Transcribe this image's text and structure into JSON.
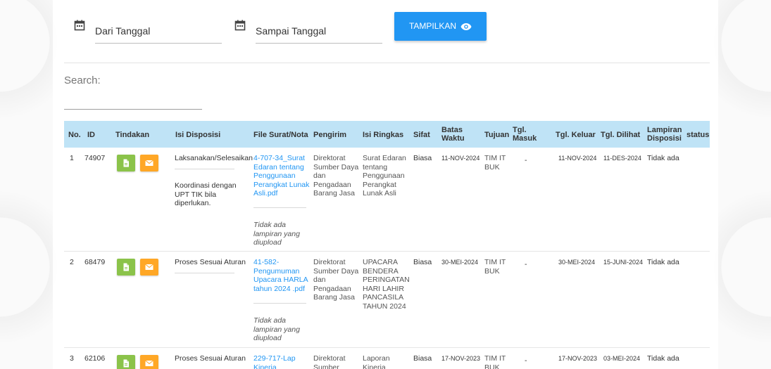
{
  "filters": {
    "from_label": "Dari Tanggal",
    "to_label": "Sampai Tanggal",
    "show_button": "TAMPILKAN",
    "search_label": "Search:"
  },
  "table": {
    "headers": {
      "no": "No.",
      "id": "ID",
      "action": "Tindakan",
      "disposition": "Isi Disposisi",
      "file": "File Surat/Nota",
      "sender": "Pengirim",
      "summary": "Isi Ringkas",
      "nature": "Sifat",
      "deadline": "Batas Waktu",
      "target": "Tujuan",
      "in_date": "Tgl. Masuk",
      "out_date": "Tgl. Keluar",
      "seen_date": "Tgl. Dilihat",
      "attachment": "Lampiran Disposisi",
      "status": "status"
    },
    "rows": [
      {
        "no": "1",
        "id": "74907",
        "disposition_1": "Laksanakan/Selesaikan",
        "disposition_2": "Koordinasi dengan UPT TIK bila diperlukan.",
        "file": "4-707-34_Surat Edaran tentang Penggunaan Perangkat Lunak Asli.pdf",
        "no_attachment": "Tidak ada lampiran yang diupload",
        "sender": "Direktorat Sumber Daya dan Pengadaan Barang Jasa",
        "summary": "Surat Edaran tentang Penggunaan Perangkat Lunak Asli",
        "nature": "Biasa",
        "deadline": "11-NOV-2024",
        "target": "TIM IT BUK",
        "in_date": "-",
        "out_date": "11-NOV-2024",
        "seen_date": "11-DES-2024",
        "attachment": "Tidak ada"
      },
      {
        "no": "2",
        "id": "68479",
        "disposition_1": "Proses Sesuai Aturan",
        "disposition_2": "",
        "file": "41-582-Pengumuman Upacara HARLA tahun 2024 .pdf",
        "no_attachment": "Tidak ada lampiran yang diupload",
        "sender": "Direktorat Sumber Daya dan Pengadaan Barang Jasa",
        "summary": "UPACARA BENDERA PERINGATAN HARI LAHIR PANCASILA TAHUN 2024",
        "nature": "Biasa",
        "deadline": "30-MEI-2024",
        "target": "TIM IT BUK",
        "in_date": "-",
        "out_date": "30-MEI-2024",
        "seen_date": "15-JUNI-2024",
        "attachment": "Tidak ada"
      },
      {
        "no": "3",
        "id": "62106",
        "disposition_1": "Proses Sesuai Aturan",
        "disposition_2": "",
        "file": "229-717-Lap Kinerja",
        "no_attachment": "",
        "sender": "Direktorat Sumber",
        "summary": "Laporan Kinerja",
        "nature": "Biasa",
        "deadline": "17-NOV-2023",
        "target": "TIM IT BUK",
        "in_date": "-",
        "out_date": "17-NOV-2023",
        "seen_date": "03-MEI-2024",
        "attachment": "Tidak ada"
      }
    ]
  },
  "colors": {
    "primary": "#2196f3",
    "header_bg": "#bfe3f6",
    "btn_green": "#8bc34a",
    "btn_orange": "#ffa726"
  },
  "icons": {
    "calendar": "calendar-icon",
    "eye": "eye-icon",
    "document": "document-icon",
    "mail": "mail-icon"
  }
}
